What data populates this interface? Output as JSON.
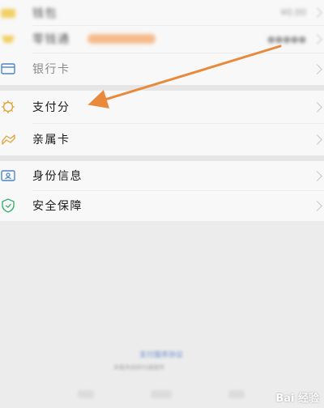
{
  "menu": {
    "top_items": [
      {
        "label": "钱包",
        "value": "¥0.00"
      },
      {
        "label": "零钱通",
        "value": ""
      }
    ],
    "bank_card": {
      "label": "银行卡"
    },
    "group2": [
      {
        "label": "支付分"
      },
      {
        "label": "亲属卡"
      }
    ],
    "group3": [
      {
        "label": "身份信息"
      },
      {
        "label": "安全保障"
      }
    ]
  },
  "footer": {
    "link": "支付服务协议",
    "copy": "本服务由财付通提供"
  },
  "watermark": "Bai 经验",
  "colors": {
    "arrow": "#e8893c",
    "yellow_icon": "#f0c232",
    "blue_icon": "#4f86c6",
    "green_icon": "#3fae6e",
    "gold_icon": "#e0a43a"
  }
}
